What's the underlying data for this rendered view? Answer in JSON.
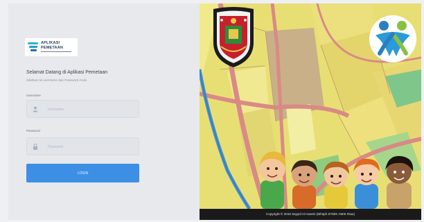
{
  "login": {
    "logo_line1": "APLIKASI",
    "logo_line2": "PEMETAAN",
    "title": "Selamat Datang di Aplikasi Pemetaan",
    "subtitle": "Silahkan isi username dan Password Anda",
    "username_label": "Username",
    "username_placeholder": "Username",
    "username_value": "",
    "password_label": "Password",
    "password_placeholder": "Password",
    "password_value": "",
    "login_button": "LOGIN"
  },
  "map": {
    "footer": "Copyright © 2019 Sayyid Al Husein (Mhsph STMIK AMIK Riau)"
  },
  "colors": {
    "accent": "#3d8fe6",
    "panel_bg": "#e7e9ed",
    "footer_bg": "#1a1a1a"
  },
  "icons": [
    "user-icon",
    "lock-icon",
    "app-logo-icon",
    "crest-emblem",
    "kota-layak-anak-logo"
  ]
}
